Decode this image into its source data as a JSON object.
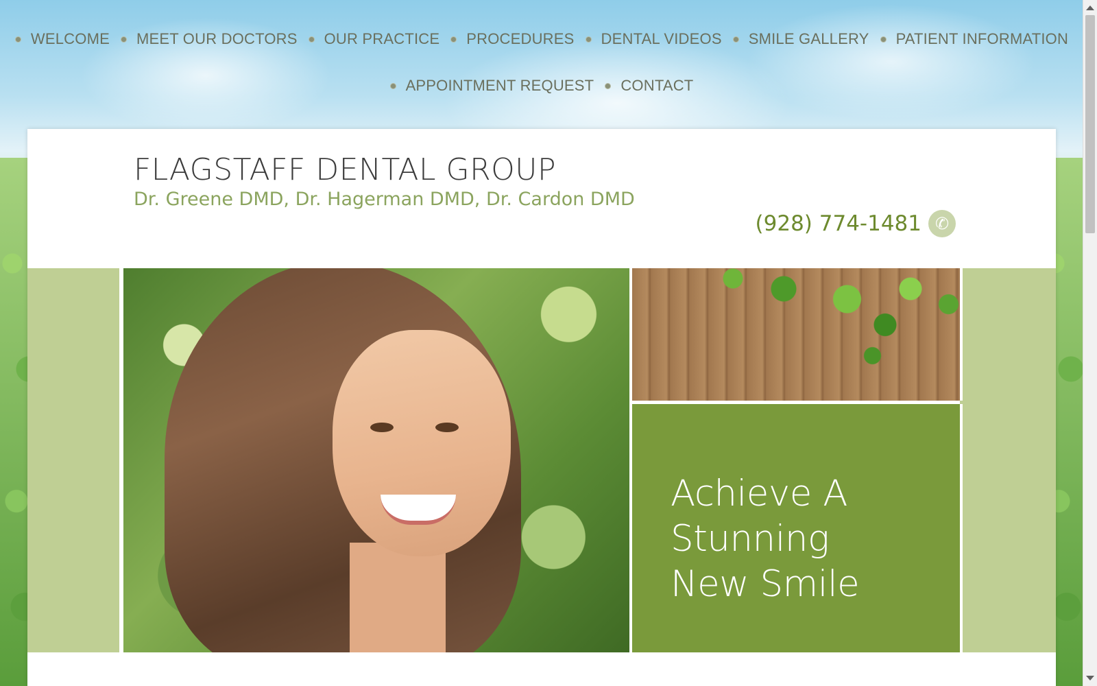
{
  "nav": {
    "row1": [
      "WELCOME",
      "MEET OUR DOCTORS",
      "OUR PRACTICE",
      "PROCEDURES",
      "DENTAL VIDEOS",
      "SMILE GALLERY",
      "PATIENT INFORMATION"
    ],
    "row2": [
      "APPOINTMENT REQUEST",
      "CONTACT"
    ]
  },
  "header": {
    "title": "FLAGSTAFF DENTAL GROUP",
    "subtitle": "Dr. Greene DMD, Dr. Hagerman DMD, Dr. Cardon DMD",
    "phone": "(928) 774-1481",
    "phone_icon": "phone-icon"
  },
  "hero": {
    "promo_lines": [
      "Achieve A",
      "Stunning",
      "New Smile"
    ]
  },
  "colors": {
    "accent_green": "#7a9a3b",
    "light_green": "#bfcf94",
    "subtitle_green": "#8ba45e",
    "phone_green": "#6d8a2e"
  }
}
